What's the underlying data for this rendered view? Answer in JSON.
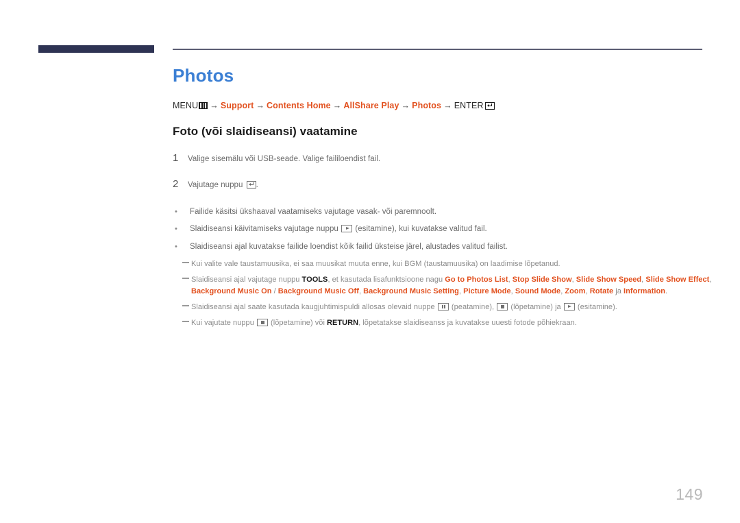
{
  "document": {
    "page_number": "149",
    "title": "Photos",
    "title_color": "#3b7fd4",
    "link_color": "#e2511f",
    "header_bar_color": "#2e3353",
    "header_rule_color": "#5c5d73"
  },
  "breadcrumb": {
    "items": [
      {
        "label": "MENU",
        "type": "plain",
        "icon": "menu-icon"
      },
      {
        "label": "Support",
        "type": "link"
      },
      {
        "label": "Contents Home",
        "type": "link"
      },
      {
        "label": "AllShare Play",
        "type": "link"
      },
      {
        "label": "Photos",
        "type": "link"
      },
      {
        "label": "ENTER",
        "type": "plain",
        "icon": "enter-icon"
      }
    ],
    "arrow": "→"
  },
  "section": {
    "heading": "Foto (või slaidiseansi) vaatamine"
  },
  "steps": [
    {
      "num": "1",
      "text": "Valige sisemälu või USB-seade. Valige faililoendist fail."
    },
    {
      "num": "2",
      "text_before": "Vajutage nuppu ",
      "icon": "enter-icon",
      "text_after": "."
    }
  ],
  "bullets": [
    {
      "marker": "•",
      "text_before": "Failide käsitsi ükshaaval vaatamiseks vajutage vasak- või paremnoolt.",
      "icon": "",
      "text_after": ""
    },
    {
      "marker": "•",
      "text_before": "Slaidiseansi käivitamiseks vajutage nuppu ",
      "icon": "play-icon",
      "text_after": " (esitamine), kui kuvatakse valitud fail."
    },
    {
      "marker": "•",
      "text_before": "Slaidiseansi ajal kuvatakse failide loendist kõik failid üksteise järel, alustades valitud failist.",
      "icon": "",
      "text_after": ""
    }
  ],
  "notes": [
    {
      "id": "note-bgm",
      "parts": [
        {
          "type": "plain",
          "text": "Kui valite vale taustamuusika, ei saa muusikat muuta enne, kui BGM (taustamuusika) on laadimise lõpetanud."
        }
      ]
    },
    {
      "id": "note-tools",
      "parts": [
        {
          "type": "plain",
          "text": "Slaidiseansi ajal vajutage nuppu "
        },
        {
          "type": "bold-black",
          "text": "TOOLS"
        },
        {
          "type": "plain",
          "text": ", et kasutada lisafunktsioone nagu "
        },
        {
          "type": "bold-orange",
          "text": "Go to Photos List"
        },
        {
          "type": "plain",
          "text": ", "
        },
        {
          "type": "bold-orange",
          "text": "Stop Slide Show"
        },
        {
          "type": "plain",
          "text": ", "
        },
        {
          "type": "bold-orange",
          "text": "Slide Show Speed"
        },
        {
          "type": "plain",
          "text": ", "
        },
        {
          "type": "bold-orange",
          "text": "Slide Show Effect"
        },
        {
          "type": "plain",
          "text": ", "
        },
        {
          "type": "bold-orange",
          "text": "Background Music On"
        },
        {
          "type": "plain",
          "text": " / "
        },
        {
          "type": "bold-orange",
          "text": "Background Music Off"
        },
        {
          "type": "plain",
          "text": ", "
        },
        {
          "type": "bold-orange",
          "text": "Background Music Setting"
        },
        {
          "type": "plain",
          "text": ", "
        },
        {
          "type": "bold-orange",
          "text": "Picture Mode"
        },
        {
          "type": "plain",
          "text": ", "
        },
        {
          "type": "bold-orange",
          "text": "Sound Mode"
        },
        {
          "type": "plain",
          "text": ", "
        },
        {
          "type": "bold-orange",
          "text": "Zoom"
        },
        {
          "type": "plain",
          "text": ", "
        },
        {
          "type": "bold-orange",
          "text": "Rotate"
        },
        {
          "type": "plain",
          "text": " ja "
        },
        {
          "type": "bold-orange",
          "text": "Information"
        },
        {
          "type": "plain",
          "text": "."
        }
      ]
    },
    {
      "id": "note-remote-keys",
      "parts": [
        {
          "type": "plain",
          "text": "Slaidiseansi ajal saate kasutada kaugjuhtimispuldi allosas olevaid nuppe "
        },
        {
          "type": "icon",
          "icon": "pause-icon"
        },
        {
          "type": "plain",
          "text": " (peatamine), "
        },
        {
          "type": "icon",
          "icon": "stop-icon"
        },
        {
          "type": "plain",
          "text": " (lõpetamine) ja "
        },
        {
          "type": "icon",
          "icon": "play-icon"
        },
        {
          "type": "plain",
          "text": " (esitamine)."
        }
      ]
    },
    {
      "id": "note-return",
      "parts": [
        {
          "type": "plain",
          "text": "Kui vajutate nuppu "
        },
        {
          "type": "icon",
          "icon": "stop-icon"
        },
        {
          "type": "plain",
          "text": " (lõpetamine) või "
        },
        {
          "type": "bold-black",
          "text": "RETURN"
        },
        {
          "type": "plain",
          "text": ", lõpetatakse slaidiseanss ja kuvatakse uuesti fotode põhiekraan."
        }
      ]
    }
  ]
}
